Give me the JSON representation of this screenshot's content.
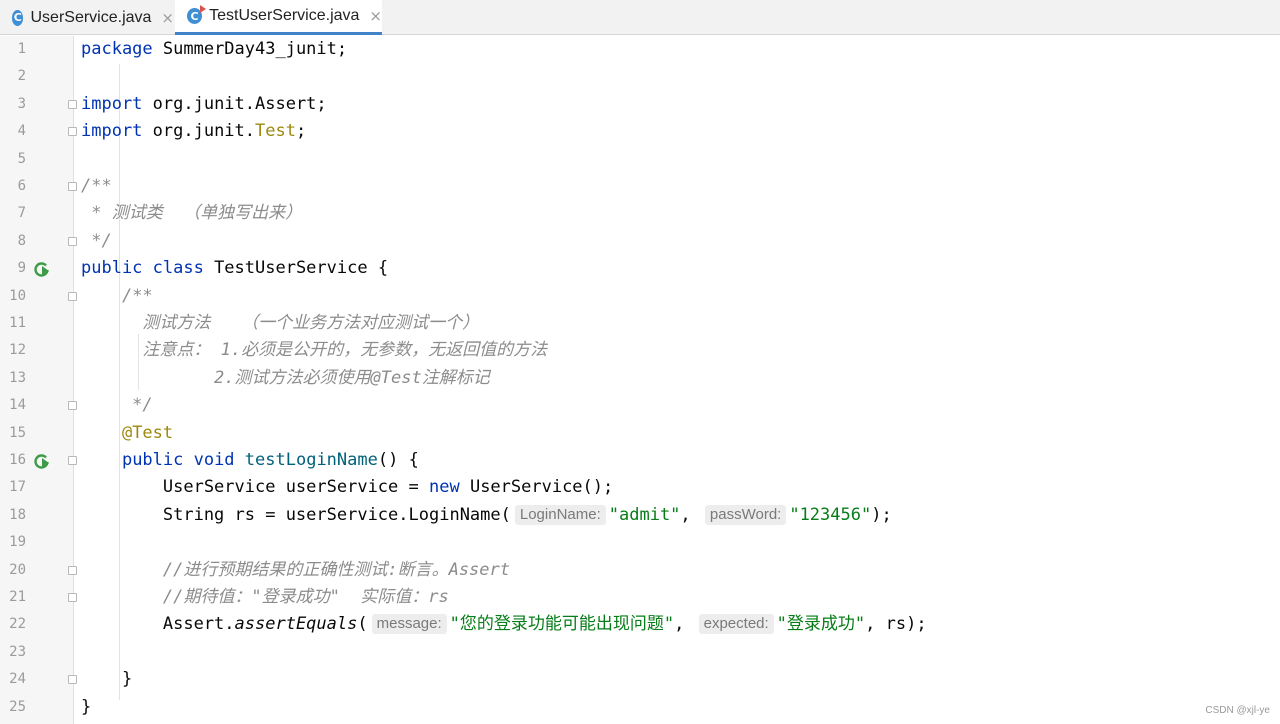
{
  "tabs": [
    {
      "label": "UserService.java",
      "icon": "java-class-icon",
      "active": false
    },
    {
      "label": "TestUserService.java",
      "icon": "java-test-class-icon",
      "active": true
    }
  ],
  "tab_close_glyph": "×",
  "class_icon_letter": "C",
  "colors": {
    "accent": "#4083c9",
    "keyword": "#0033b3",
    "annotation": "#9e880d",
    "string": "#067d17",
    "comment": "#8c8c8c",
    "method": "#00627a"
  },
  "lines": [
    {
      "n": "1",
      "gutter": "",
      "tokens": [
        {
          "t": "package",
          "c": "kw"
        },
        {
          "t": " SummerDay43_junit;"
        }
      ]
    },
    {
      "n": "2",
      "gutter": "",
      "tokens": []
    },
    {
      "n": "3",
      "gutter": "fold",
      "tokens": [
        {
          "t": "import",
          "c": "kw"
        },
        {
          "t": " org.junit.Assert;"
        }
      ]
    },
    {
      "n": "4",
      "gutter": "fold",
      "tokens": [
        {
          "t": "import",
          "c": "kw"
        },
        {
          "t": " org.junit."
        },
        {
          "t": "Test",
          "c": "ann"
        },
        {
          "t": ";"
        }
      ]
    },
    {
      "n": "5",
      "gutter": "",
      "tokens": []
    },
    {
      "n": "6",
      "gutter": "fold",
      "tokens": [
        {
          "t": "/**",
          "c": "cmt"
        }
      ]
    },
    {
      "n": "7",
      "gutter": "",
      "tokens": [
        {
          "t": " * 测试类  （单独写出来）",
          "c": "cmt"
        }
      ]
    },
    {
      "n": "8",
      "gutter": "fold",
      "tokens": [
        {
          "t": " */",
          "c": "cmt"
        }
      ]
    },
    {
      "n": "9",
      "gutter": "run",
      "tokens": [
        {
          "t": "public class",
          "c": "kw"
        },
        {
          "t": " TestUserService {"
        }
      ]
    },
    {
      "n": "10",
      "gutter": "fold",
      "tokens": [
        {
          "t": "    "
        },
        {
          "t": "/**",
          "c": "cmt"
        }
      ]
    },
    {
      "n": "11",
      "gutter": "",
      "tokens": [
        {
          "t": "      测试方法   （一个业务方法对应测试一个）",
          "c": "cmt"
        }
      ]
    },
    {
      "n": "12",
      "gutter": "",
      "tokens": [
        {
          "t": "      注意点： 1.必须是公开的，无参数，无返回值的方法",
          "c": "cmt"
        }
      ]
    },
    {
      "n": "13",
      "gutter": "",
      "tokens": [
        {
          "t": "             2.测试方法必须使用@Test注解标记",
          "c": "cmt"
        }
      ]
    },
    {
      "n": "14",
      "gutter": "fold",
      "tokens": [
        {
          "t": "     */",
          "c": "cmt"
        }
      ]
    },
    {
      "n": "15",
      "gutter": "",
      "tokens": [
        {
          "t": "    "
        },
        {
          "t": "@Test",
          "c": "ann"
        }
      ]
    },
    {
      "n": "16",
      "gutter": "run-fold",
      "tokens": [
        {
          "t": "    "
        },
        {
          "t": "public void",
          "c": "kw"
        },
        {
          "t": " "
        },
        {
          "t": "testLoginName",
          "c": "fn"
        },
        {
          "t": "() {"
        }
      ]
    },
    {
      "n": "17",
      "gutter": "",
      "tokens": [
        {
          "t": "        UserService userService = "
        },
        {
          "t": "new",
          "c": "kw"
        },
        {
          "t": " UserService();"
        }
      ]
    },
    {
      "n": "18",
      "gutter": "",
      "tokens": [
        {
          "t": "        String rs = userService.LoginName("
        },
        {
          "t": "LoginName:",
          "c": "hint"
        },
        {
          "t": "\"admit\"",
          "c": "str"
        },
        {
          "t": ", "
        },
        {
          "t": "passWord:",
          "c": "hint"
        },
        {
          "t": "\"123456\"",
          "c": "str"
        },
        {
          "t": ");"
        }
      ]
    },
    {
      "n": "19",
      "gutter": "",
      "tokens": []
    },
    {
      "n": "20",
      "gutter": "fold",
      "tokens": [
        {
          "t": "        //进行预期结果的正确性测试:断言。Assert",
          "c": "cmt"
        }
      ]
    },
    {
      "n": "21",
      "gutter": "fold",
      "tokens": [
        {
          "t": "        //期待值：\"登录成功\"  实际值：rs",
          "c": "cmt"
        }
      ]
    },
    {
      "n": "22",
      "gutter": "",
      "tokens": [
        {
          "t": "        Assert."
        },
        {
          "t": "assertEquals",
          "c": "it"
        },
        {
          "t": "("
        },
        {
          "t": "message:",
          "c": "hint"
        },
        {
          "t": "\"您的登录功能可能出现问题\"",
          "c": "str"
        },
        {
          "t": ", "
        },
        {
          "t": "expected:",
          "c": "hint"
        },
        {
          "t": "\"登录成功\"",
          "c": "str"
        },
        {
          "t": ", rs);"
        }
      ]
    },
    {
      "n": "23",
      "gutter": "",
      "tokens": []
    },
    {
      "n": "24",
      "gutter": "fold",
      "tokens": [
        {
          "t": "    }"
        }
      ]
    },
    {
      "n": "25",
      "gutter": "",
      "tokens": [
        {
          "t": "}"
        }
      ]
    }
  ],
  "watermark": "CSDN @xjl-ye"
}
